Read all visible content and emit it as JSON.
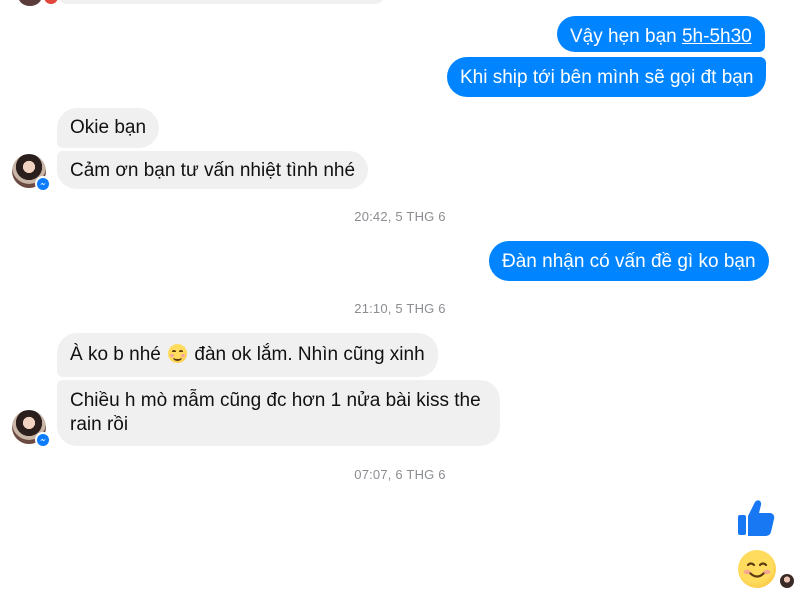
{
  "conversation": {
    "outgoing_1": {
      "prefix": "Vậy hẹn bạn ",
      "link": "5h-5h30"
    },
    "outgoing_2": "Khi ship tới bên mình sẽ gọi đt bạn",
    "incoming_1": "Okie bạn",
    "incoming_2": "Cảm ơn bạn tư vấn nhiệt tình nhé",
    "timestamp_1": "20:42, 5 THG 6",
    "outgoing_3": "Đàn nhận có vấn đề gì ko bạn",
    "timestamp_2": "21:10, 5 THG 6",
    "incoming_3": {
      "before_emoji": "À ko b nhé ",
      "after_emoji": " đàn ok lắm. Nhìn cũng xinh"
    },
    "incoming_4": {
      "line1": "Chiều h mò mẫm cũng đc hơn 1 nửa bài kiss the",
      "line2": "rain rồi"
    },
    "timestamp_3": "07:07, 6 THG 6"
  },
  "icons": {
    "thumbs_up": "thumbs-up-icon",
    "smile_emoji": "smiling-face-emoji",
    "inline_emoji": "smiling-face-emoji",
    "messenger_badge": "messenger-icon"
  },
  "colors": {
    "outgoing_bubble": "#0084ff",
    "incoming_bubble": "#f0f0f0",
    "timestamp_text": "#8a8d91",
    "like_blue": "#0a7cff"
  }
}
